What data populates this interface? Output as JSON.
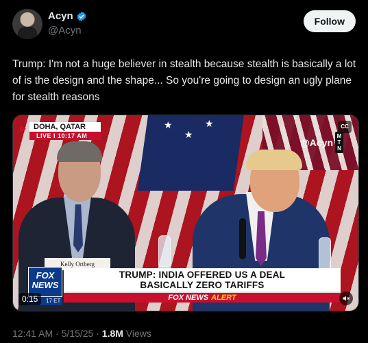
{
  "author": {
    "display_name": "Acyn",
    "handle": "@Acyn",
    "verified": true
  },
  "follow_button": {
    "label": "Follow"
  },
  "tweet": {
    "text": "Trump: I'm not a huge believer in stealth because stealth is basically a lot of is the design and the shape... So you're going to design an ugly plane for stealth reasons"
  },
  "video": {
    "location_label": "DOHA, QATAR",
    "live_label": "LIVE",
    "live_time": "10:17 AM",
    "watermark": "@Acyn",
    "watermark_badge": [
      "M",
      "T",
      "N"
    ],
    "nameplate": "Kelly Ortberg",
    "chyron_line1": "TRUMP: INDIA OFFERED US A DEAL",
    "chyron_line2": "BASICALLY ZERO TARIFFS",
    "alert_brand": "FOX NEWS",
    "alert_word": "ALERT",
    "network_logo": "FOX NEWS",
    "clock_chip": "17 ET",
    "elapsed": "0:15",
    "colors": {
      "fox_blue": "#0b3a8a",
      "fox_red": "#c8102e",
      "alert_yellow": "#ffd000"
    }
  },
  "footer": {
    "time": "12:41 AM",
    "separator": "·",
    "date": "5/15/25",
    "views_count": "1.8M",
    "views_label": "Views"
  },
  "icons": [
    "avatar",
    "verified-badge-icon",
    "captions-icon",
    "mute-icon",
    "live-arrow-icon"
  ]
}
